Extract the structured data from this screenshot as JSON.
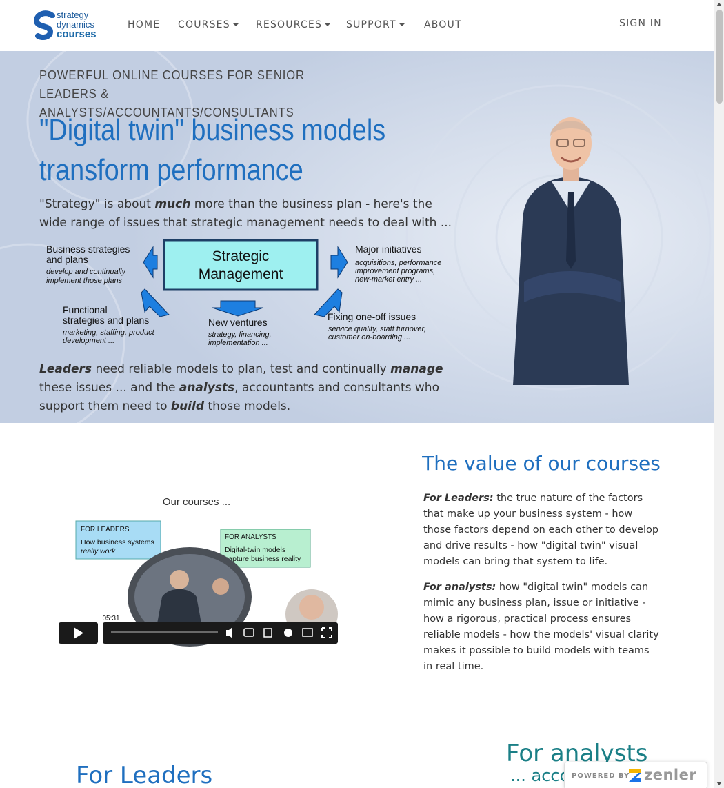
{
  "logo": {
    "line1": "strategy",
    "line2": "dynamics",
    "line3": "courses"
  },
  "nav": {
    "home": "HOME",
    "courses": "COURSES",
    "resources": "RESOURCES",
    "support": "SUPPORT",
    "about": "ABOUT",
    "sign_in": "SIGN IN"
  },
  "hero": {
    "kicker": "POWERFUL ONLINE COURSES FOR SENIOR LEADERS & ANALYSTS/ACCOUNTANTS/CONSULTANTS",
    "title": "\"Digital twin\" business models transform performance",
    "intro_before": "\"Strategy\" is about ",
    "intro_em": "much",
    "intro_after": " more than the business plan - here's the wide range of issues that strategic management needs to deal with ...",
    "diagram": {
      "center": "Strategic Management",
      "tl_title": "Business strategies and plans",
      "tl_sub": "develop and continually implement those plans",
      "tr_title": "Major initiatives",
      "tr_sub": "acquisitions, performance improvement programs, new-market entry ...",
      "bl_title": "Functional strategies and plans",
      "bl_sub": "marketing, staffing, product development ...",
      "bm_title": "New ventures",
      "bm_sub": "strategy, financing, implementation ...",
      "br_title": "Fixing one-off issues",
      "br_sub": "service quality, staff turnover, customer on-boarding ..."
    },
    "bottom": {
      "leaders": "Leaders",
      "t1": " need reliable models to plan, test and continually ",
      "manage": "manage",
      "t2": " these issues ... and the ",
      "analysts": "analysts",
      "t3": ", accountants and consultants who support them need to ",
      "build": "build",
      "t4": " those models."
    }
  },
  "video": {
    "heading": "Our courses ...",
    "leaders_box_title": "FOR LEADERS",
    "leaders_box_text": "How business systems",
    "leaders_box_em": "really work",
    "analysts_box_title": "FOR ANALYSTS",
    "analysts_box_text1": "Digital-twin models",
    "analysts_box_text2": "capture business reality",
    "time": "05:31",
    "progress": 0
  },
  "value": {
    "title": "The value of our courses",
    "leaders_label": "For Leaders:",
    "leaders_text": " the true nature of the factors that make up your business system - how those factors depend on each other to develop and drive results - how \"digital twin\" visual models can bring that system to life.",
    "analysts_label": "For analysts:",
    "analysts_text": " how \"digital twin\" models can mimic any business plan, issue or initiative - how a rigorous, practical process ensures reliable models - how the models' visual clarity makes it possible to build models with teams in real time."
  },
  "sections": {
    "leaders_heading": "For Leaders",
    "analysts_heading": "For analysts",
    "analysts_sub": "... acco"
  },
  "badge": {
    "powered": "POWERED BY",
    "brand": "zenler"
  },
  "colors": {
    "accent": "#1f6fbf",
    "teal": "#1a7f86",
    "hero_bg": "#c3cfe3"
  }
}
